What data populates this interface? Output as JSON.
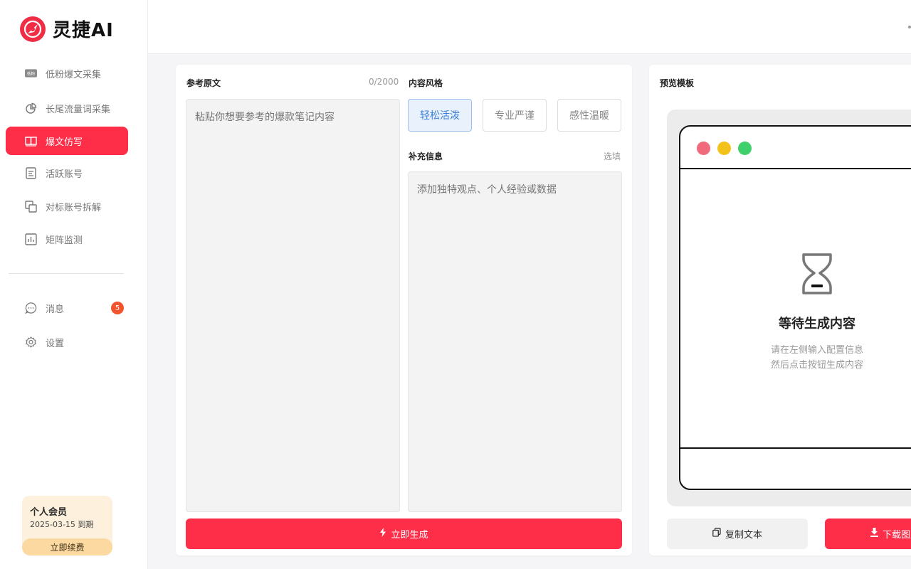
{
  "brand": {
    "name": "灵捷AI",
    "color": "#ef2d45"
  },
  "sidebar": {
    "items": [
      {
        "label": "低粉爆文采集",
        "icon": "low-follower-tag-icon",
        "active": false
      },
      {
        "label": "长尾流量词采集",
        "icon": "pie-chart-icon",
        "active": false
      },
      {
        "label": "爆文仿写",
        "icon": "book-icon",
        "active": true
      },
      {
        "label": "活跃账号",
        "icon": "document-icon",
        "active": false
      },
      {
        "label": "对标账号拆解",
        "icon": "copy-split-icon",
        "active": false
      },
      {
        "label": "矩阵监测",
        "icon": "bar-chart-icon",
        "active": false
      }
    ],
    "messages": {
      "label": "消息",
      "badge": "5"
    },
    "settings": {
      "label": "设置"
    },
    "member": {
      "title": "个人会员",
      "expiry": "2025-03-15 到期",
      "renew": "立即续费"
    },
    "tag_icon_text": "低粉"
  },
  "editor": {
    "reference": {
      "label": "参考原文",
      "count": "0/2000",
      "placeholder": "粘贴你想要参考的爆款笔记内容"
    },
    "style": {
      "label": "内容风格",
      "options": [
        "轻松活泼",
        "专业严谨",
        "感性温暖"
      ],
      "selected": "轻松活泼"
    },
    "extra": {
      "label": "补充信息",
      "hint": "选填",
      "placeholder": "添加独特观点、个人经验或数据"
    },
    "generate": "立即生成"
  },
  "preview": {
    "label": "预览模板",
    "wait_title": "等待生成内容",
    "wait_line1": "请在左侧输入配置信息",
    "wait_line2": "然后点击按钮生成内容",
    "copy": "复制文本",
    "download": "下载图片",
    "dots": [
      "#f06a7b",
      "#f2c21b",
      "#3fcf6b"
    ]
  },
  "colors": {
    "accent": "#fe2d48",
    "selected_blue": "#3b7fd6"
  }
}
